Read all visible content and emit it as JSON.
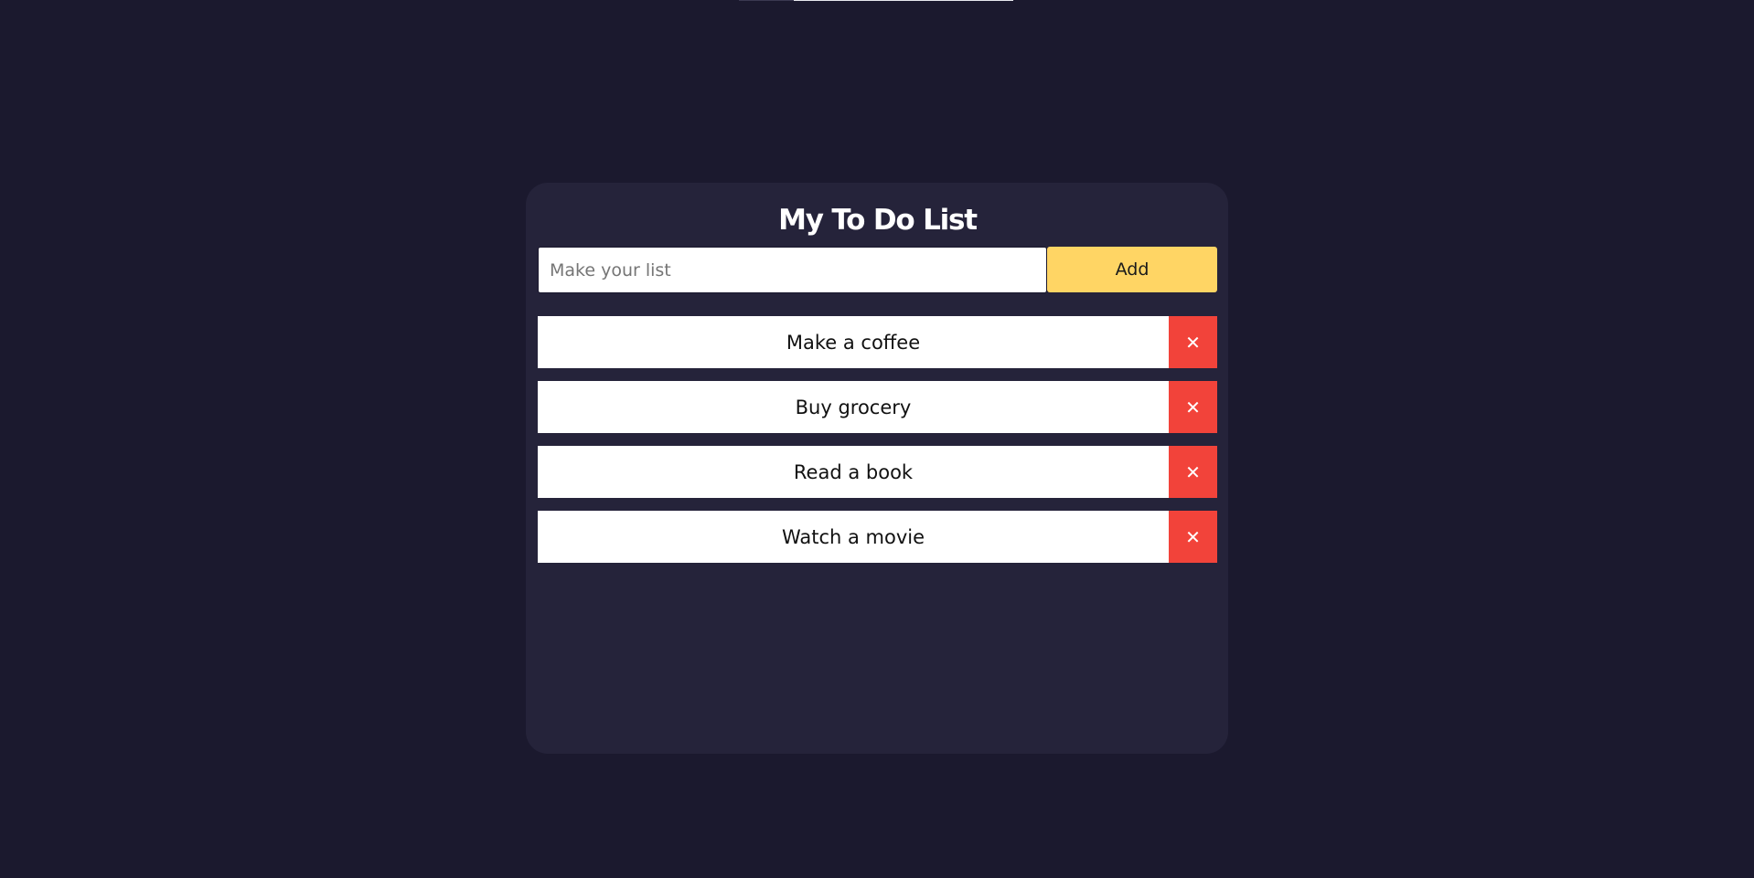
{
  "app": {
    "title": "My To Do List"
  },
  "input": {
    "placeholder": "Make your list",
    "value": ""
  },
  "add_button": {
    "label": "Add"
  },
  "todos": [
    {
      "text": "Make a coffee",
      "delete_icon": "close-icon",
      "delete_glyph": "✕"
    },
    {
      "text": "Buy grocery",
      "delete_icon": "close-icon",
      "delete_glyph": "✕"
    },
    {
      "text": "Read a book",
      "delete_icon": "close-icon",
      "delete_glyph": "✕"
    },
    {
      "text": "Watch a movie",
      "delete_icon": "close-icon",
      "delete_glyph": "✕"
    }
  ],
  "colors": {
    "background": "#1b192e",
    "card": "#25233a",
    "accent": "#ffd564",
    "danger": "#f2433a",
    "text_light": "#ffffff"
  }
}
